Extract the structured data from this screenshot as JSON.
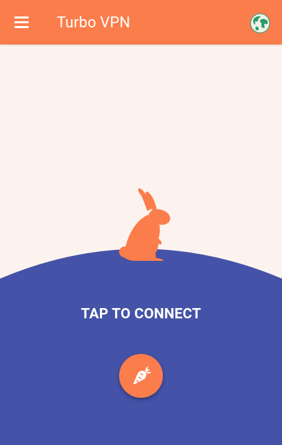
{
  "app": {
    "title": "Turbo VPN"
  },
  "toolbar": {
    "menu_icon": "hamburger-menu-icon",
    "server_icon": "globe-icon"
  },
  "main": {
    "connect_label": "TAP TO CONNECT",
    "connect_icon": "carrot-icon",
    "mascot": "rabbit-illustration"
  },
  "colors": {
    "accent": "#fb7d4b",
    "background": "#fcf3ef",
    "hill": "#4452a7",
    "globe_land": "#2e9b6c",
    "globe_sea": "#f0f0e8"
  }
}
